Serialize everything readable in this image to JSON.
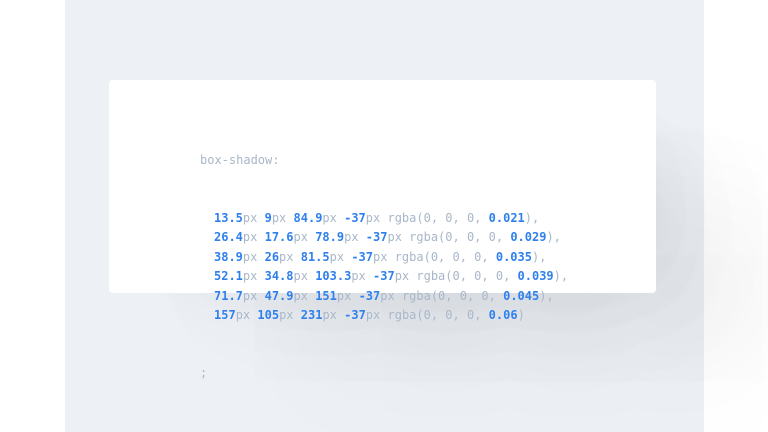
{
  "code": {
    "property": "box-shadow:",
    "terminator": ";",
    "layers": [
      {
        "x": "13.5",
        "y": "9",
        "blur": "84.9",
        "spread": "-37",
        "alpha": "0.021",
        "end": "),"
      },
      {
        "x": "26.4",
        "y": "17.6",
        "blur": "78.9",
        "spread": "-37",
        "alpha": "0.029",
        "end": "),"
      },
      {
        "x": "38.9",
        "y": "26",
        "blur": "81.5",
        "spread": "-37",
        "alpha": "0.035",
        "end": "),"
      },
      {
        "x": "52.1",
        "y": "34.8",
        "blur": "103.3",
        "spread": "-37",
        "alpha": "0.039",
        "end": "),"
      },
      {
        "x": "71.7",
        "y": "47.9",
        "blur": "151",
        "spread": "-37",
        "alpha": "0.045",
        "end": "),"
      },
      {
        "x": "157",
        "y": "105",
        "blur": "231",
        "spread": "-37",
        "alpha": "0.06",
        "end": ")"
      }
    ],
    "unit": "px",
    "rgba_prefix": "rgba(0, 0, 0, "
  },
  "colors": {
    "number": "#2f80ed",
    "muted": "#a9b7c8",
    "background": "#edf1f6",
    "card": "#ffffff"
  }
}
